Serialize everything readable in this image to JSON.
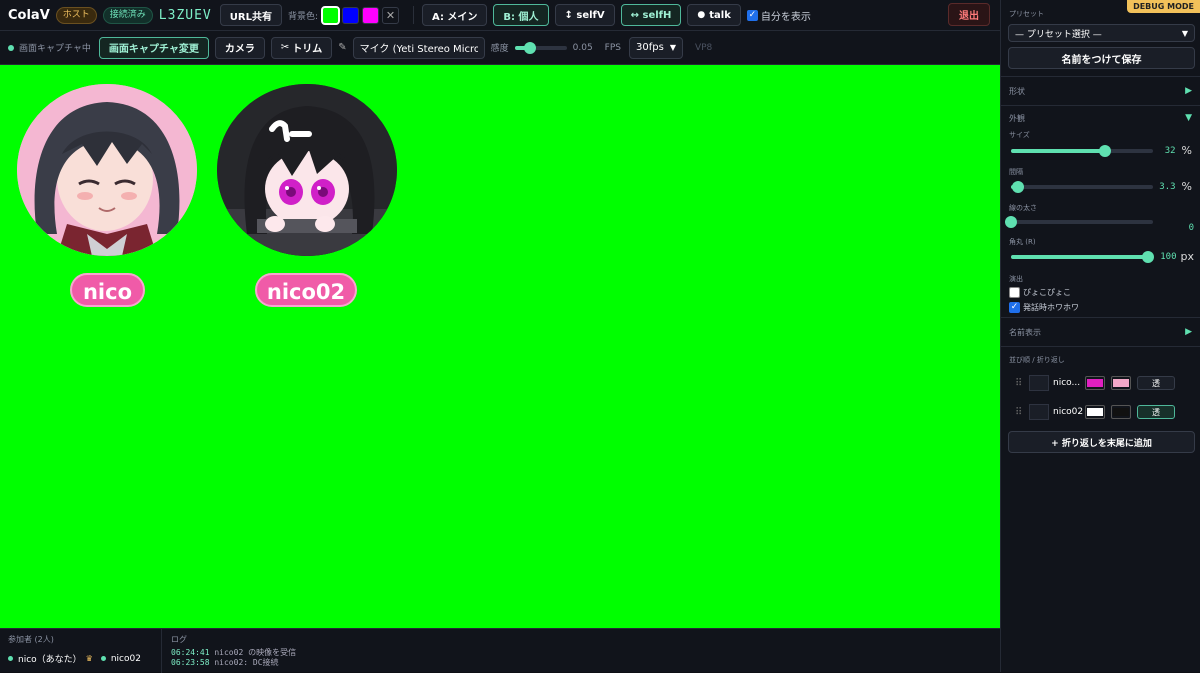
{
  "topbar": {
    "brand": "ColaV",
    "host_badge": "ホスト",
    "status_badge": "接続済み",
    "room_code": "L3ZUEV",
    "share_button": "URL共有",
    "bg_label": "背景色:",
    "bg_colors": [
      "#00ff00",
      "#0000ff",
      "#ff00ff"
    ],
    "bg_clear": "✕",
    "mode_a": "A: メイン",
    "mode_b": "B: 個人",
    "selfv": "↕ selfV",
    "selfh": "↔ selfH",
    "talk": "talk",
    "show_self": "自分を表示",
    "exit": "退出"
  },
  "toolbar2": {
    "capturing": "画面キャプチャ中",
    "change_capture": "画面キャプチャ変更",
    "camera": "カメラ",
    "trim": "トリム",
    "mic_select": "マイク (Yeti Stereo Microphone",
    "sensitivity_label": "感度",
    "sensitivity_value": "0.05",
    "sensitivity_level": 0.3,
    "fps_label": "FPS",
    "fps_value": "30fps",
    "codec": "VP8"
  },
  "stage": {
    "avatars": [
      {
        "name": "nico",
        "ring": "#f4b7d2"
      },
      {
        "name": "nico02",
        "ring": "#2a2a2e"
      }
    ]
  },
  "bottom": {
    "participants_title": "参加者 (2人)",
    "participants": [
      "nico（あなた）",
      "nico02"
    ],
    "log_title": "ログ",
    "log": [
      {
        "time": "06:24:41",
        "msg": "nico02 の映像を受信"
      },
      {
        "time": "06:23:58",
        "msg": "nico02: DC接続"
      }
    ]
  },
  "sidebar": {
    "debug": "DEBUG MODE",
    "preset_label": "プリセット",
    "preset_select": "— プリセット選択 —",
    "save_named": "名前をつけて保存",
    "shape": "形状",
    "appearance": "外観",
    "size_label": "サイズ",
    "size_value": "32",
    "size_unit": "%",
    "size_level": 0.66,
    "gap_label": "間隔",
    "gap_value": "3.3",
    "gap_unit": "%",
    "gap_level": 0.05,
    "border_label": "線の太さ",
    "border_value": "0",
    "border_level": 0.0,
    "radius_label": "角丸 (R)",
    "radius_value": "100",
    "radius_unit": "px",
    "radius_level": 1.0,
    "effects_label": "演出",
    "effect_bounce": "ぴょこぴょこ",
    "effect_speak": "発話時ホワホワ",
    "name_display": "名前表示",
    "order_label": "並び順 / 折り返し",
    "order_rows": [
      {
        "name": "nico...",
        "color1": "#e020c0",
        "color2": "#f4a8c8",
        "t": "透",
        "t_on": false
      },
      {
        "name": "nico02",
        "color1": "#ffffff",
        "color2": "#111111",
        "t": "透",
        "t_on": true
      }
    ],
    "add_wrap": "+ 折り返しを末尾に追加"
  }
}
